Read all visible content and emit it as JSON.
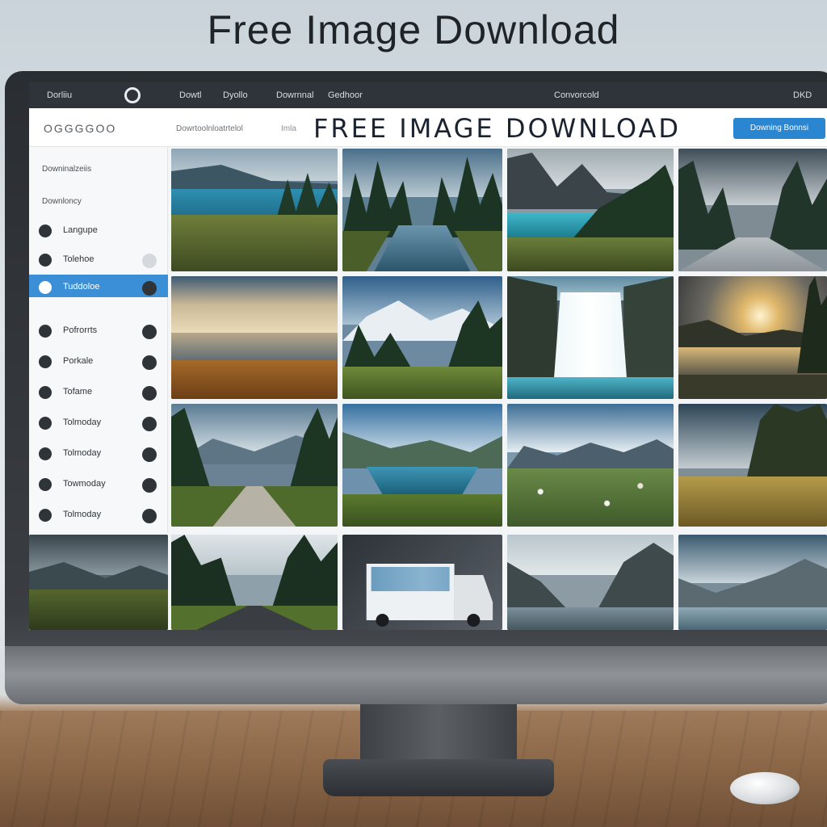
{
  "heading": "Free Image Download",
  "topbar": {
    "left_label": "Dorliiu",
    "nav": [
      "Dowtl",
      "Dyollo",
      "Dowrnnal",
      "Gedhoor"
    ],
    "center_label": "Convorcold",
    "right_label": "DKD"
  },
  "subbar": {
    "brand": "OGGGGOO",
    "links": "Dowrtoolnloatrtelol",
    "tag": "Imla",
    "title": "FREE IMAGE DOWNLOAD",
    "cta": "Downing Bonnsi"
  },
  "sidebar": {
    "heading1": "Downinalzeiis",
    "heading2": "Downloncy",
    "items": [
      {
        "label": "Langupe",
        "active": false
      },
      {
        "label": "Tolehoe",
        "active": false
      },
      {
        "label": "Tuddoloe",
        "active": true
      },
      {
        "label": "Pofrorrts",
        "active": false
      },
      {
        "label": "Porkale",
        "active": false
      },
      {
        "label": "Tofame",
        "active": false
      },
      {
        "label": "Tolmoday",
        "active": false
      },
      {
        "label": "Tolmoday",
        "active": false
      },
      {
        "label": "Towmoday",
        "active": false
      },
      {
        "label": "Tolmoday",
        "active": false
      }
    ]
  },
  "colors": {
    "accent": "#2b86d1",
    "sidebar_active": "#3a8fd6",
    "topbar": "#2f343a"
  },
  "gallery": {
    "images": [
      {
        "kind": "lake-forest"
      },
      {
        "kind": "river-pines"
      },
      {
        "kind": "mountain-lake"
      },
      {
        "kind": "forest-path"
      },
      {
        "kind": "sunset-lake"
      },
      {
        "kind": "snowy-peaks"
      },
      {
        "kind": "waterfall"
      },
      {
        "kind": "sunrise-lake"
      },
      {
        "kind": "mountain-road"
      },
      {
        "kind": "valley-lake"
      },
      {
        "kind": "flower-meadow"
      },
      {
        "kind": "field-trees"
      },
      {
        "kind": "stormy-valley"
      },
      {
        "kind": "forest-road"
      },
      {
        "kind": "camper-van"
      },
      {
        "kind": "cliff-river"
      },
      {
        "kind": "alpine-lake"
      }
    ]
  }
}
